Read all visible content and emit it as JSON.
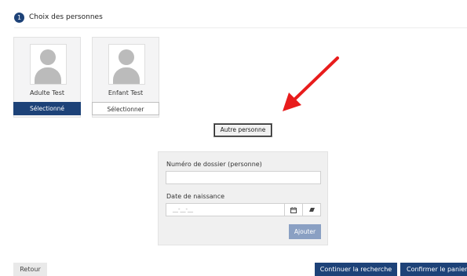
{
  "step": {
    "number": "1",
    "title": "Choix des personnes"
  },
  "persons": [
    {
      "name": "Adulte Test",
      "button_label": "Sélectionné",
      "selected": true
    },
    {
      "name": "Enfant Test",
      "button_label": "Sélectionner",
      "selected": false
    }
  ],
  "other_person_button": "Autre personne",
  "form": {
    "file_number_label": "Numéro de dossier (personne)",
    "file_number_value": "",
    "birthdate_label": "Date de naissance",
    "birthdate_placeholder": "__-__-__",
    "add_button": "Ajouter"
  },
  "footer": {
    "back": "Retour",
    "continue": "Continuer la recherche",
    "confirm": "Confirmer le panier"
  },
  "colors": {
    "primary": "#1d4278",
    "arrow": "#e81c1c",
    "disabled_button": "#8aa0c3"
  }
}
